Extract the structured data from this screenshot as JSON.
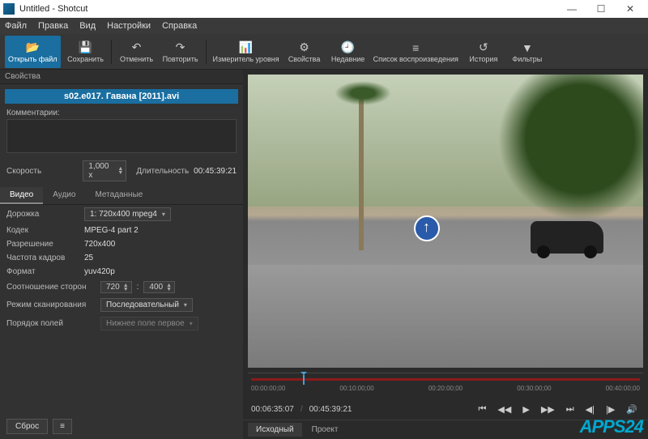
{
  "window": {
    "title": "Untitled - Shotcut"
  },
  "menu": {
    "file": "Файл",
    "edit": "Правка",
    "view": "Вид",
    "settings": "Настройки",
    "help": "Справка"
  },
  "toolbar": {
    "open": "Открыть файл",
    "save": "Сохранить",
    "undo": "Отменить",
    "redo": "Повторить",
    "meter": "Измеритель уровня",
    "props": "Свойства",
    "recent": "Недавние",
    "playlist": "Список воспроизведения",
    "history": "История",
    "filters": "Фильтры"
  },
  "panel": {
    "title": "Свойства",
    "filename": "s02.e017. Гавана [2011].avi",
    "comment_label": "Комментарии:",
    "speed_label": "Скорость",
    "speed_value": "1,000 x",
    "duration_label": "Длительность",
    "duration_value": "00:45:39:21",
    "tabs": {
      "video": "Видео",
      "audio": "Аудио",
      "meta": "Метаданные"
    },
    "track_label": "Дорожка",
    "track_value": "1: 720x400 mpeg4",
    "codec_label": "Кодек",
    "codec_value": "MPEG-4 part 2",
    "res_label": "Разрешение",
    "res_value": "720x400",
    "fps_label": "Частота кадров",
    "fps_value": "25",
    "format_label": "Формат",
    "format_value": "yuv420p",
    "aspect_label": "Соотношение сторон",
    "aspect_w": "720",
    "aspect_h": "400",
    "scan_label": "Режим сканирования",
    "scan_value": "Последовательный",
    "field_label": "Порядок полей",
    "field_value": "Нижнее поле первое",
    "reset": "Сброс"
  },
  "timeline": {
    "t0": "00:00:00;00",
    "t1": "00:10:00;00",
    "t2": "00:20:00;00",
    "t3": "00:30:00;00",
    "t4": "00:40:00;00"
  },
  "player": {
    "pos": "00:06:35:07",
    "total": "00:45:39:21"
  },
  "bottom": {
    "source": "Исходный",
    "project": "Проект"
  },
  "watermark": "APPS24"
}
